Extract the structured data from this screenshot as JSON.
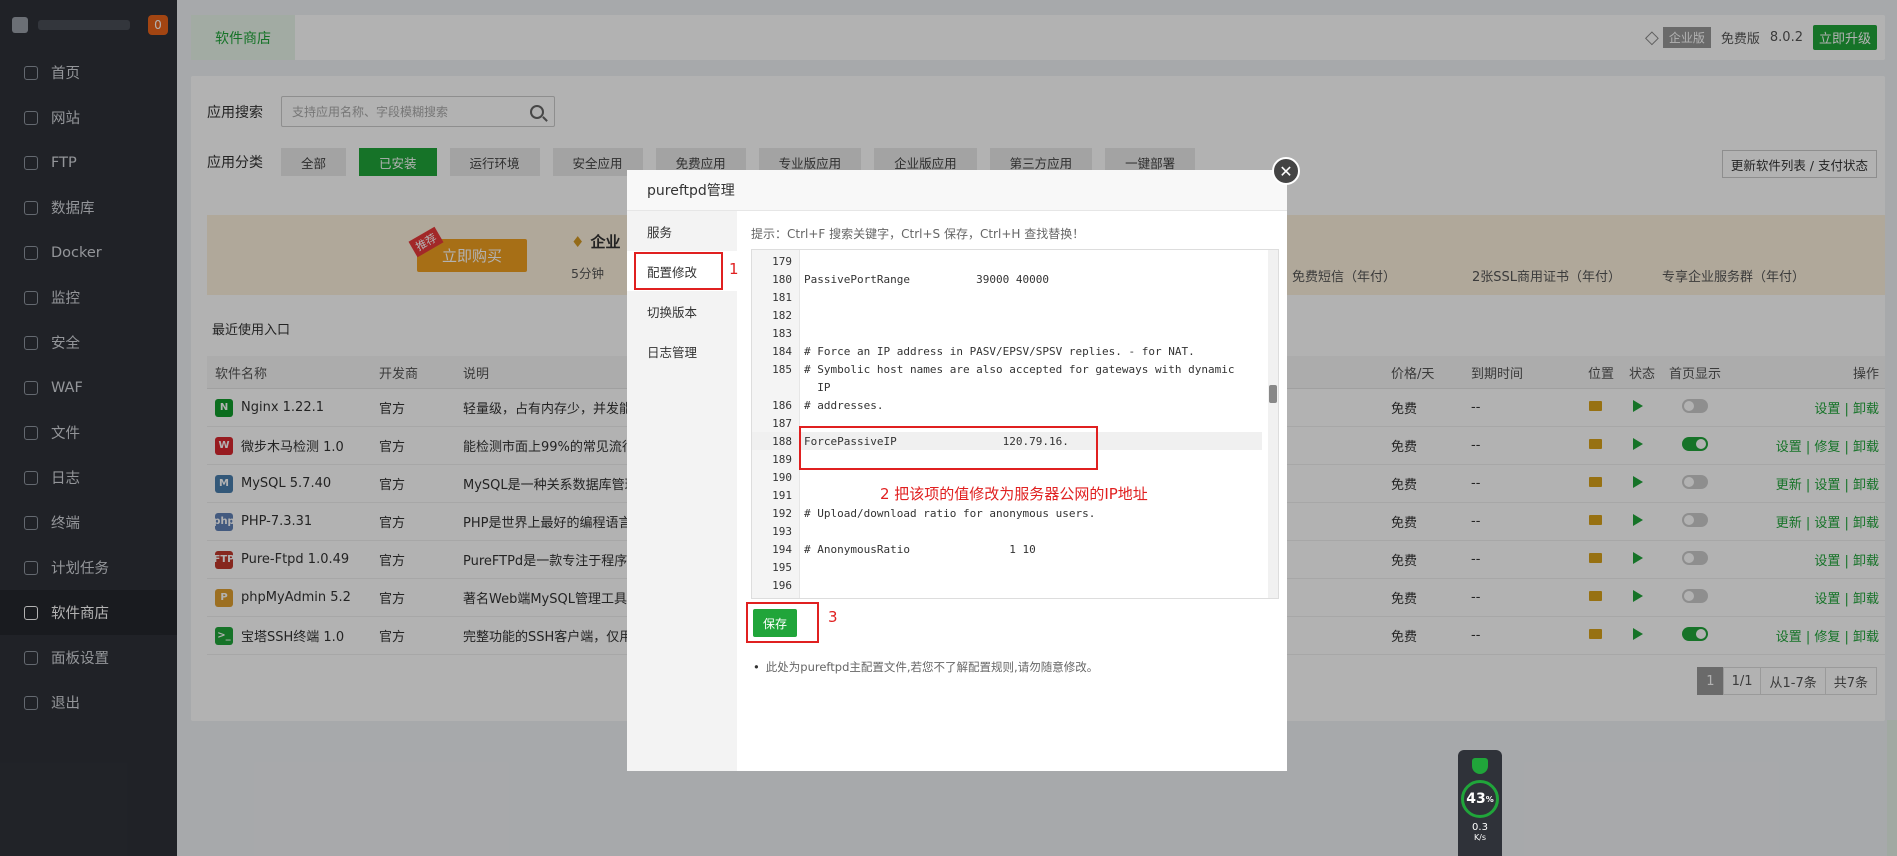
{
  "sidebar": {
    "badge": "0",
    "items": [
      {
        "label": "首页",
        "icon": "home-icon"
      },
      {
        "label": "网站",
        "icon": "globe-icon"
      },
      {
        "label": "FTP",
        "icon": "ftp-icon"
      },
      {
        "label": "数据库",
        "icon": "database-icon"
      },
      {
        "label": "Docker",
        "icon": "docker-icon"
      },
      {
        "label": "监控",
        "icon": "monitor-icon"
      },
      {
        "label": "安全",
        "icon": "shield-icon"
      },
      {
        "label": "WAF",
        "icon": "waf-icon"
      },
      {
        "label": "文件",
        "icon": "folder-icon"
      },
      {
        "label": "日志",
        "icon": "log-icon"
      },
      {
        "label": "终端",
        "icon": "terminal-icon"
      },
      {
        "label": "计划任务",
        "icon": "calendar-icon"
      },
      {
        "label": "软件商店",
        "icon": "grid-icon"
      },
      {
        "label": "面板设置",
        "icon": "gear-icon"
      },
      {
        "label": "退出",
        "icon": "logout-icon"
      }
    ]
  },
  "topbar": {
    "tab": "软件商店",
    "edition_tag": "企业版",
    "free": "免费版",
    "version": "8.0.2",
    "upgrade": "立即升级"
  },
  "search": {
    "label": "应用搜索",
    "placeholder": "支持应用名称、字段模糊搜索"
  },
  "categories": {
    "label": "应用分类",
    "items": [
      "全部",
      "已安装",
      "运行环境",
      "安全应用",
      "免费应用",
      "专业版应用",
      "企业版应用",
      "第三方应用",
      "一键部署"
    ],
    "refresh": "更新软件列表 / 支付状态"
  },
  "banner": {
    "rec": "推荐",
    "buy": "立即购买",
    "ent": "企业",
    "sub": "5分钟",
    "feat1": "免费短信（年付）",
    "feat2": "2张SSL商用证书（年付）",
    "feat3": "专享企业服务群（年付）"
  },
  "recent": "最近使用入口",
  "table": {
    "headers": {
      "name": "软件名称",
      "dev": "开发商",
      "desc": "说明",
      "price": "价格/天",
      "expire": "到期时间",
      "loc": "位置",
      "status": "状态",
      "home": "首页显示",
      "ops": "操作"
    },
    "rows": [
      {
        "name": "Nginx 1.22.1",
        "dev": "官方",
        "desc": "轻量级，占有内存少，并发能",
        "price": "免费",
        "expire": "--",
        "home": false,
        "ops": "设置 | 卸载",
        "icon_color": "#109d2c",
        "icon_text": "N"
      },
      {
        "name": "微步木马检测 1.0",
        "dev": "官方",
        "desc": "能检测市面上99%的常见流行",
        "price": "免费",
        "expire": "--",
        "home": true,
        "ops": "设置 | 修复 | 卸载",
        "icon_color": "#d9282f",
        "icon_text": "W"
      },
      {
        "name": "MySQL 5.7.40",
        "dev": "官方",
        "desc": "MySQL是一种关系数据库管理",
        "price": "免费",
        "expire": "--",
        "home": false,
        "ops": "更新 | 设置 | 卸载",
        "icon_color": "#4a7fae",
        "icon_text": "M"
      },
      {
        "name": "PHP-7.3.31",
        "dev": "官方",
        "desc": "PHP是世界上最好的编程语言",
        "price": "免费",
        "expire": "--",
        "home": false,
        "ops": "更新 | 设置 | 卸载",
        "icon_color": "#6181b6",
        "icon_text": "php"
      },
      {
        "name": "Pure-Ftpd 1.0.49",
        "dev": "官方",
        "desc": "PureFTPd是一款专注于程序健",
        "price": "免费",
        "expire": "--",
        "home": false,
        "ops": "设置 | 卸载",
        "icon_color": "#c0392b",
        "icon_text": "FTP"
      },
      {
        "name": "phpMyAdmin 5.2",
        "dev": "官方",
        "desc": "著名Web端MySQL管理工具",
        "price": "免费",
        "expire": "--",
        "home": false,
        "ops": "设置 | 卸载",
        "icon_color": "#e0a030",
        "icon_text": "P"
      },
      {
        "name": "宝塔SSH终端 1.0",
        "dev": "官方",
        "desc": "完整功能的SSH客户端，仅用",
        "price": "免费",
        "expire": "--",
        "home": true,
        "ops": "设置 | 修复 | 卸载",
        "icon_color": "#20a53a",
        "icon_text": ">_"
      }
    ]
  },
  "pager": {
    "cur": "1",
    "pages": "1/1",
    "range": "从1-7条",
    "total": "共7条"
  },
  "modal": {
    "title": "pureftpd管理",
    "side": [
      "服务",
      "配置修改",
      "切换版本",
      "日志管理"
    ],
    "hint": "提示：Ctrl+F 搜索关键字，Ctrl+S 保存，Ctrl+H 查找替换！",
    "lines": [
      {
        "n": "179",
        "t": ""
      },
      {
        "n": "180",
        "t": "PassivePortRange          39000 40000"
      },
      {
        "n": "181",
        "t": ""
      },
      {
        "n": "182",
        "t": ""
      },
      {
        "n": "183",
        "t": ""
      },
      {
        "n": "184",
        "t": "# Force an IP address in PASV/EPSV/SPSV replies. - for NAT."
      },
      {
        "n": "185",
        "t": "# Symbolic host names are also accepted for gateways with dynamic"
      },
      {
        "n": "",
        "t": "  IP"
      },
      {
        "n": "186",
        "t": "# addresses."
      },
      {
        "n": "187",
        "t": ""
      },
      {
        "n": "188",
        "t": "ForcePassiveIP                120.79.16."
      },
      {
        "n": "189",
        "t": ""
      },
      {
        "n": "190",
        "t": ""
      },
      {
        "n": "191",
        "t": ""
      },
      {
        "n": "192",
        "t": "# Upload/download ratio for anonymous users."
      },
      {
        "n": "193",
        "t": ""
      },
      {
        "n": "194",
        "t": "# AnonymousRatio               1 10"
      },
      {
        "n": "195",
        "t": ""
      },
      {
        "n": "196",
        "t": ""
      }
    ],
    "save": "保存",
    "note": "此处为pureftpd主配置文件,若您不了解配置规则,请勿随意修改。"
  },
  "annotations": {
    "a1": "1",
    "a2": "2 把该项的值修改为服务器公网的IP地址",
    "a3": "3"
  },
  "speed": {
    "percent": "43",
    "unit": "%",
    "rate": "0.3",
    "rate_unit": "K/s"
  },
  "colors": {
    "accent": "#20a53a",
    "annotation": "#e02020",
    "sidebar": "#2f3239"
  }
}
